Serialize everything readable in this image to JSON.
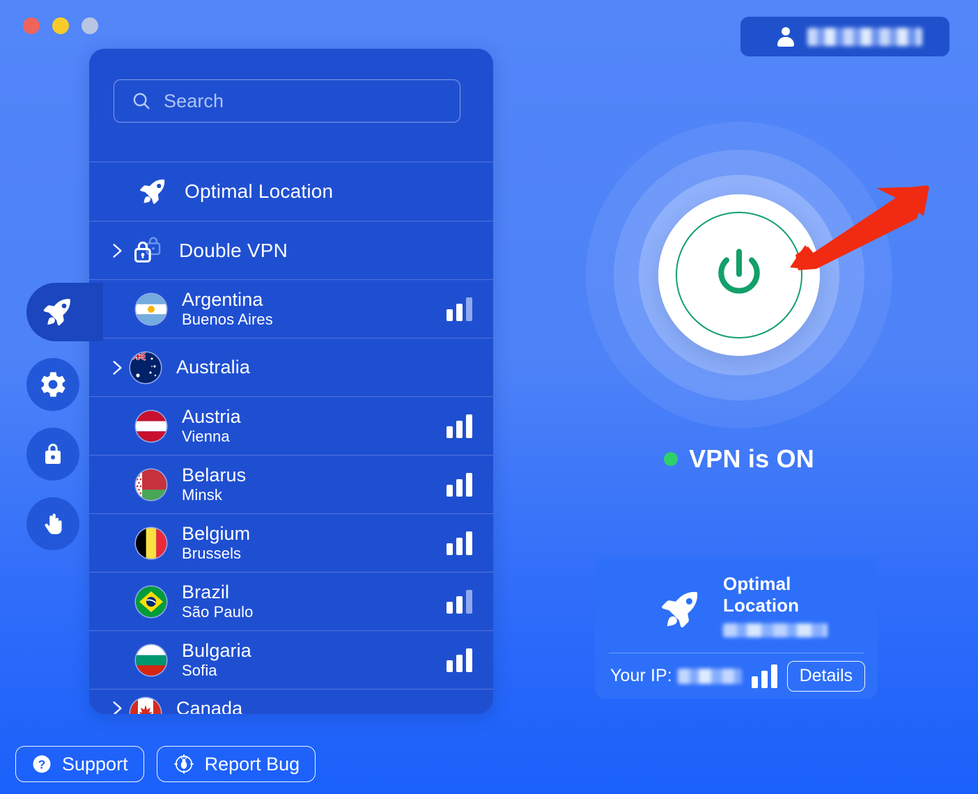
{
  "window": {
    "traffic_lights": [
      "close",
      "minimize",
      "maximize-disabled"
    ]
  },
  "account": {
    "icon": "person-icon",
    "name_redacted": true,
    "name": ""
  },
  "rail": {
    "items": [
      {
        "icon": "rocket-icon",
        "name": "servers",
        "active": true
      },
      {
        "icon": "gear-icon",
        "name": "settings",
        "active": false
      },
      {
        "icon": "lock-icon",
        "name": "security",
        "active": false
      },
      {
        "icon": "hand-icon",
        "name": "privacy",
        "active": false
      }
    ]
  },
  "search": {
    "icon": "search-icon",
    "placeholder": "Search",
    "value": ""
  },
  "server_list": {
    "special": [
      {
        "label": "Optimal Location",
        "icon": "rocket-icon",
        "expandable": false
      },
      {
        "label": "Double VPN",
        "icon": "double-lock-icon",
        "expandable": true
      }
    ],
    "countries": [
      {
        "country": "Argentina",
        "city": "Buenos Aires",
        "flag": "ar",
        "expandable": false,
        "signal": 2
      },
      {
        "country": "Australia",
        "city": "",
        "flag": "au",
        "expandable": true,
        "signal": 0
      },
      {
        "country": "Austria",
        "city": "Vienna",
        "flag": "at",
        "expandable": false,
        "signal": 3
      },
      {
        "country": "Belarus",
        "city": "Minsk",
        "flag": "by",
        "expandable": false,
        "signal": 3
      },
      {
        "country": "Belgium",
        "city": "Brussels",
        "flag": "be",
        "expandable": false,
        "signal": 3
      },
      {
        "country": "Brazil",
        "city": "São Paulo",
        "flag": "br",
        "expandable": false,
        "signal": 2
      },
      {
        "country": "Bulgaria",
        "city": "Sofia",
        "flag": "bg",
        "expandable": false,
        "signal": 3
      },
      {
        "country": "Canada",
        "city": "",
        "flag": "ca",
        "expandable": true,
        "signal": 0
      }
    ]
  },
  "connection": {
    "power_icon": "power-icon",
    "status_text": "VPN is ON",
    "status_dot_color": "#2fd06a",
    "power_accent_color": "#13a06a"
  },
  "location_card": {
    "icon": "rocket-icon",
    "title": "Optimal Location",
    "sublabel_redacted": true,
    "ip_label": "Your IP:",
    "ip_redacted": true,
    "signal": 3,
    "details_label": "Details"
  },
  "footer": {
    "support_label": "Support",
    "support_icon": "question-circle-icon",
    "report_bug_label": "Report Bug",
    "report_bug_icon": "bug-target-icon"
  },
  "annotation": {
    "arrow_color": "#f02b11",
    "points_to": "power-button"
  }
}
